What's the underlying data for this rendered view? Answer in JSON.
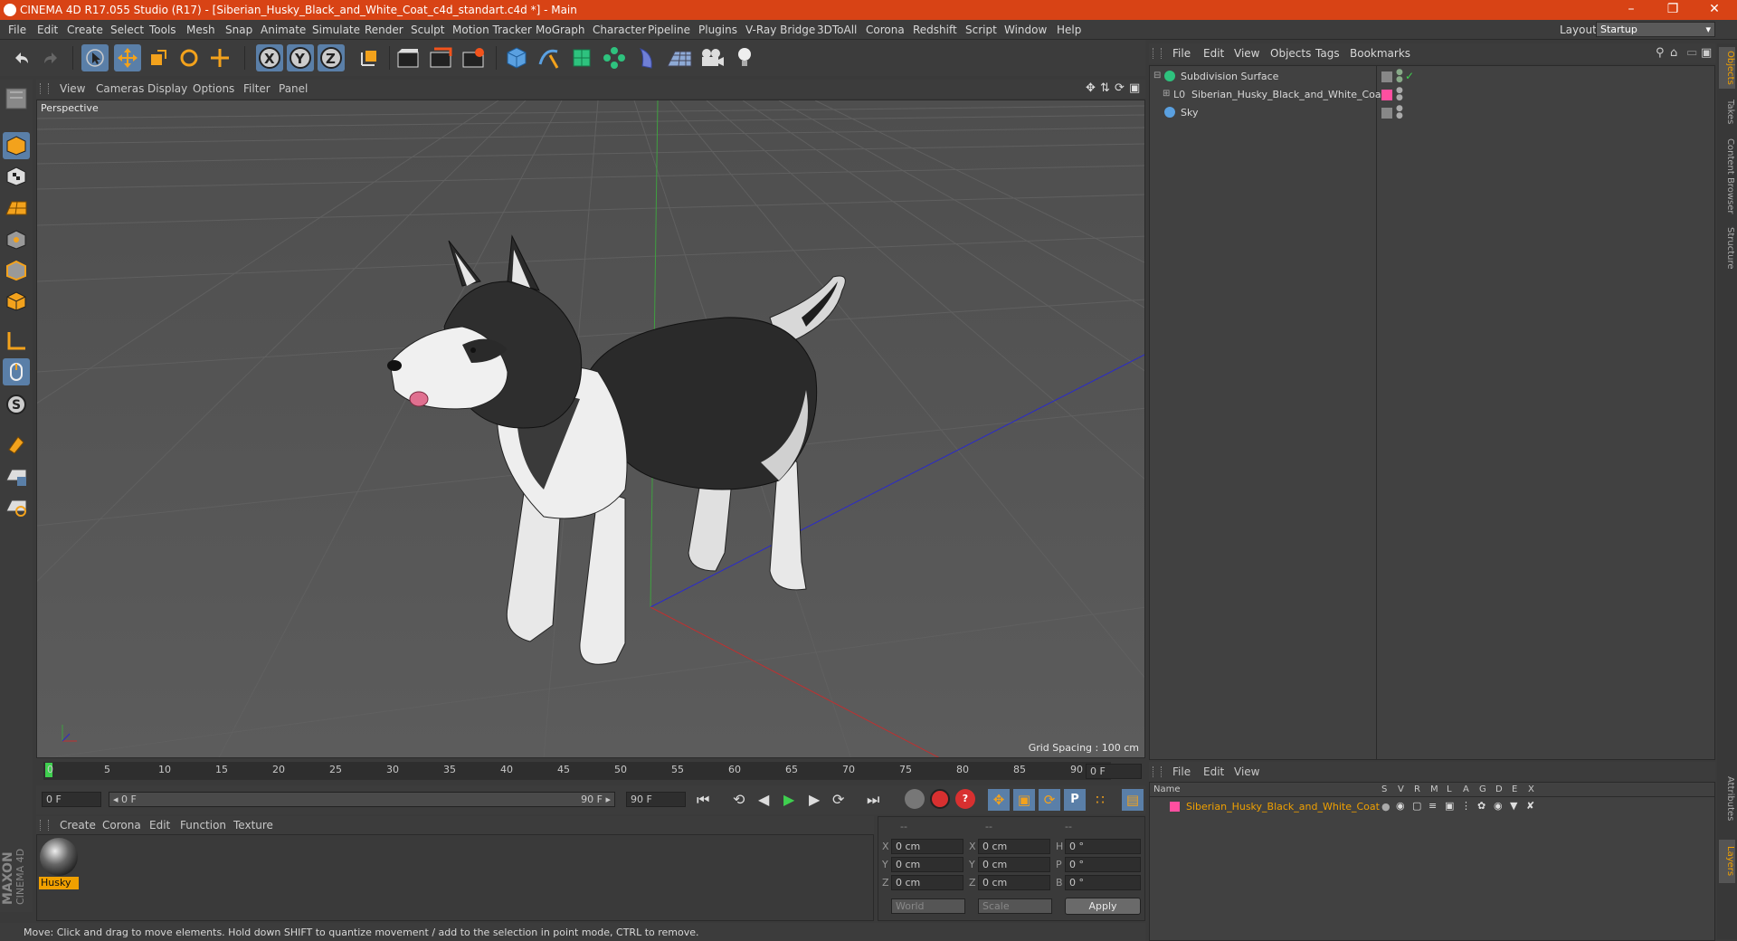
{
  "window": {
    "title": "CINEMA 4D R17.055 Studio (R17) - [Siberian_Husky_Black_and_White_Coat_c4d_standart.c4d *] - Main",
    "controls": [
      "–",
      "❐",
      "✕"
    ]
  },
  "menu": [
    "File",
    "Edit",
    "Create",
    "Select",
    "Tools",
    "Mesh",
    "Snap",
    "Animate",
    "Simulate",
    "Render",
    "Sculpt",
    "Motion Tracker",
    "MoGraph",
    "Character",
    "Pipeline",
    "Plugins",
    "V-Ray Bridge",
    "3DToAll",
    "Corona",
    "Redshift",
    "Script",
    "Window",
    "Help"
  ],
  "layout": {
    "label": "Layout:",
    "value": "Startup"
  },
  "toolbar_icons": [
    "undo-icon",
    "redo-icon",
    "select-icon",
    "move-icon",
    "scale-icon",
    "rotate-icon",
    "live-select-icon",
    "x-axis-icon",
    "y-axis-icon",
    "z-axis-icon",
    "coordinate-system-icon",
    "render-view-icon",
    "render-picture-viewer-icon",
    "edit-render-settings-icon",
    "cube-icon",
    "spline-pen-icon",
    "subdivision-icon",
    "array-icon",
    "deformer-icon",
    "floor-icon",
    "camera-icon",
    "light-icon"
  ],
  "viewport": {
    "menu": [
      "View",
      "Cameras",
      "Display",
      "Options",
      "Filter",
      "Panel"
    ],
    "label": "Perspective",
    "grid_spacing": "Grid Spacing : 100 cm"
  },
  "timeline": {
    "ticks": [
      "0",
      "5",
      "10",
      "15",
      "20",
      "25",
      "30",
      "35",
      "40",
      "45",
      "50",
      "55",
      "60",
      "65",
      "70",
      "75",
      "80",
      "85",
      "90"
    ],
    "current_frame": "0 F",
    "start_field": "0 F",
    "range_start": "◂ 0 F",
    "range_end": "90 F ▸",
    "end_field": "90 F"
  },
  "material": {
    "menu": [
      "Create",
      "Corona",
      "Edit",
      "Function",
      "Texture"
    ],
    "items": [
      {
        "name": "Husky"
      }
    ]
  },
  "coords": {
    "headers": [
      "--",
      "--",
      "--"
    ],
    "rows": [
      {
        "a": "X",
        "av": "0 cm",
        "b": "X",
        "bv": "0 cm",
        "c": "H",
        "cv": "0 °"
      },
      {
        "a": "Y",
        "av": "0 cm",
        "b": "Y",
        "bv": "0 cm",
        "c": "P",
        "cv": "0 °"
      },
      {
        "a": "Z",
        "av": "0 cm",
        "b": "Z",
        "bv": "0 cm",
        "c": "B",
        "cv": "0 °"
      }
    ],
    "world": "World",
    "scale": "Scale",
    "apply": "Apply"
  },
  "status": "Move: Click and drag to move elements. Hold down SHIFT to quantize movement / add to the selection in point mode, CTRL to remove.",
  "object_manager": {
    "menu": [
      "File",
      "Edit",
      "View",
      "Objects",
      "Tags",
      "Bookmarks"
    ],
    "objects": [
      {
        "name": "Subdivision Surface"
      },
      {
        "name": "Siberian_Husky_Black_and_White_Coat"
      },
      {
        "name": "Sky"
      }
    ]
  },
  "layer_manager": {
    "menu": [
      "File",
      "Edit",
      "View"
    ],
    "columns": [
      "Name",
      "S",
      "V",
      "R",
      "M",
      "L",
      "A",
      "G",
      "D",
      "E",
      "X"
    ],
    "layers": [
      {
        "name": "Siberian_Husky_Black_and_White_Coat",
        "color": "#ff4fa0"
      }
    ]
  },
  "right_tabs": [
    "Objects",
    "Takes",
    "Content Browser",
    "Structure",
    "Attributes",
    "Layers"
  ],
  "branding": {
    "maxon": "MAXON",
    "product": "CINEMA 4D"
  },
  "colors": {
    "title_bar": "#d84315",
    "accent_blue": "#5a7fa8",
    "layer_pink": "#ff4fa0",
    "highlight_orange": "#f0a000"
  }
}
